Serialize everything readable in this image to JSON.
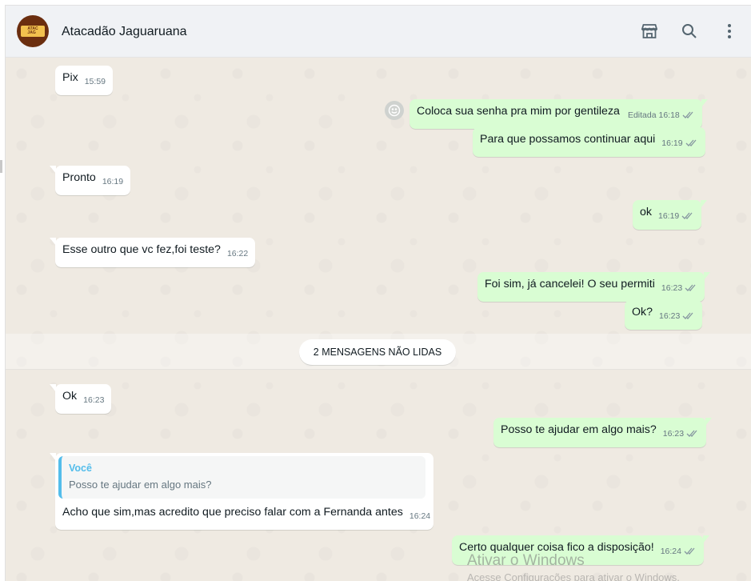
{
  "header": {
    "contact_name": "Atacadão Jaguaruana",
    "avatar_logo": "Atacadão Jaguaruana",
    "icons": [
      "store-icon",
      "search-icon",
      "menu-dots-icon"
    ]
  },
  "messages": [
    {
      "dir": "in",
      "text": "Pix",
      "time": "15:59"
    },
    {
      "dir": "out",
      "text": "Coloca sua senha pra mim por gentileza",
      "edited": "Editada",
      "time": "16:18"
    },
    {
      "dir": "out",
      "text": "Para que possamos continuar aqui",
      "time": "16:19"
    },
    {
      "dir": "in",
      "text": "Pronto",
      "time": "16:19"
    },
    {
      "dir": "out",
      "text": "ok",
      "time": "16:19"
    },
    {
      "dir": "in",
      "text": "Esse outro que vc fez,foi teste?",
      "time": "16:22"
    },
    {
      "dir": "out",
      "text": "Foi sim, já cancelei! O seu permiti",
      "time": "16:23"
    },
    {
      "dir": "out",
      "text": "Ok?",
      "time": "16:23"
    },
    {
      "dir": "in",
      "text": "Ok",
      "time": "16:23"
    },
    {
      "dir": "out",
      "text": "Posso te ajudar em algo mais?",
      "time": "16:23"
    },
    {
      "dir": "in",
      "text": "Acho que sim,mas acredito que preciso falar com a Fernanda antes",
      "time": "16:24",
      "quote": {
        "author": "Você",
        "text": "Posso te ajudar em algo mais?"
      }
    },
    {
      "dir": "out",
      "text": "Certo qualquer coisa fico a disposição!",
      "time": "16:24"
    }
  ],
  "unread_divider": "2 MENSAGENS NÃO LIDAS",
  "watermark": {
    "title": "Ativar o Windows",
    "subtitle": "Acesse Configurações para ativar o Windows."
  },
  "colors": {
    "incoming": "#ffffff",
    "outgoing": "#d9fdd3",
    "background": "#efeae2",
    "header": "#f0f2f5",
    "quote_accent": "#53bdeb"
  }
}
